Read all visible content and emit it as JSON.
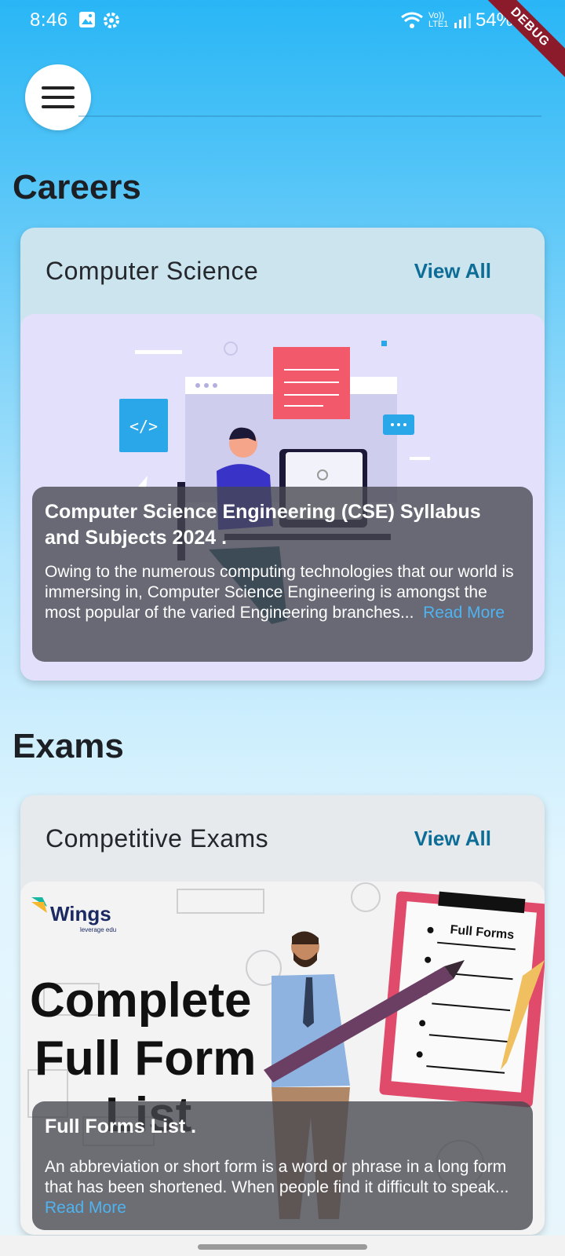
{
  "status": {
    "time": "8:46",
    "battery": "54%",
    "network": "Vo)) LTE1",
    "debug": "DEBUG"
  },
  "sections": {
    "careers": {
      "title": "Careers",
      "card": {
        "category": "Computer Science",
        "view_all": "View All",
        "article_title": "Computer Science Engineering (CSE) Syllabus and Subjects 2024 .",
        "article_desc": "Owing to the numerous computing technologies that our world is immersing in, Computer Science Engineering is amongst the most popular of the varied Engineering branches...",
        "read_more": "Read More"
      }
    },
    "exams": {
      "title": "Exams",
      "card": {
        "category": "Competitive Exams",
        "view_all": "View All",
        "article_title": "Full Forms List .",
        "article_desc": "An abbreviation or short form is a word or phrase in a long form that has been shortened. When people find it difficult to speak...",
        "read_more": "Read More",
        "image_brand": "Wings",
        "image_brand_sub": "leverage edu",
        "image_headline": [
          "Complete",
          "Full Form",
          "List"
        ],
        "clipboard_title": "Full Forms"
      }
    }
  },
  "icons": [
    "menu-icon",
    "image-icon",
    "settings-icon",
    "wifi-icon",
    "signal-icon",
    "battery-icon"
  ],
  "colors": {
    "accent": "#0d6d96",
    "link": "#4fb3f0",
    "bg_top": "#29b6f6"
  }
}
